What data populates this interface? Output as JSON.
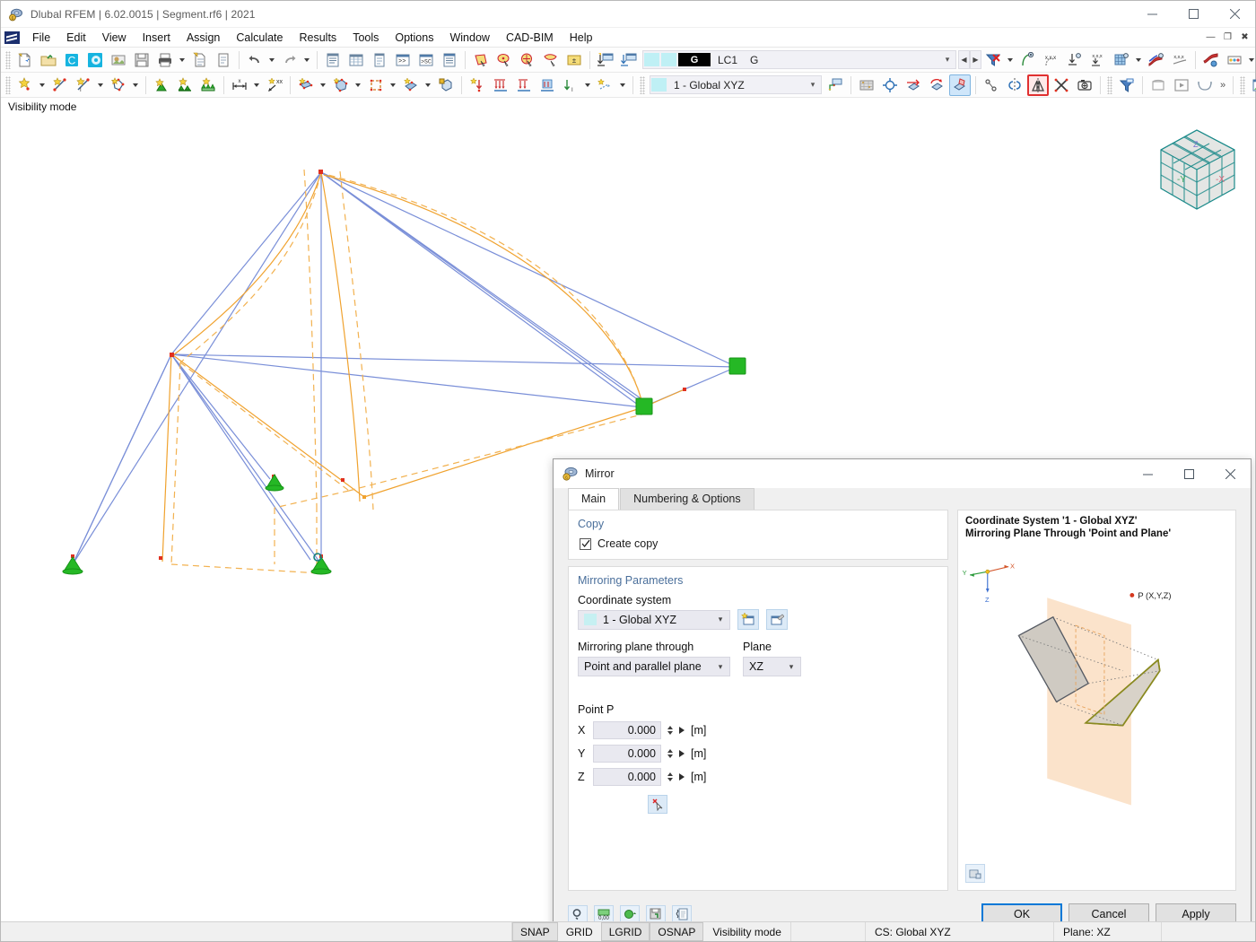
{
  "window": {
    "title": "Dlubal RFEM | 6.02.0015 | Segment.rf6 | 2021",
    "icon": "rfem-app-icon",
    "minimize": "—",
    "maximize": "□",
    "close": "✕"
  },
  "mdi": {
    "minimize": "—",
    "restore": "❐",
    "close": "✖"
  },
  "menu": {
    "items": [
      {
        "label": "File"
      },
      {
        "label": "Edit"
      },
      {
        "label": "View"
      },
      {
        "label": "Insert"
      },
      {
        "label": "Assign"
      },
      {
        "label": "Calculate"
      },
      {
        "label": "Results"
      },
      {
        "label": "Tools"
      },
      {
        "label": "Options"
      },
      {
        "label": "Window"
      },
      {
        "label": "CAD-BIM"
      },
      {
        "label": "Help"
      }
    ]
  },
  "toolbar_main": {
    "load_case_combo": {
      "label_g": "G",
      "case": "LC1",
      "name": "G"
    },
    "nav_left": "◀",
    "nav_right": "▶"
  },
  "toolbar_model": {
    "coordinate_system": "1 - Global XYZ",
    "overflow": "»"
  },
  "status_line": {
    "mode": "Visibility mode"
  },
  "statusbar": {
    "toggles": [
      {
        "label": "SNAP",
        "on": true
      },
      {
        "label": "GRID",
        "on": false
      },
      {
        "label": "LGRID",
        "on": true
      },
      {
        "label": "OSNAP",
        "on": true
      }
    ],
    "mode": "Visibility mode",
    "cs": "CS: Global XYZ",
    "plane": "Plane: XZ"
  },
  "viewcube": {
    "label_x": "-X",
    "label_y": "-Y",
    "label_z": "Z"
  },
  "dialog": {
    "title": "Mirror",
    "icon": "mirror-dialog-icon",
    "minimize": "—",
    "maximize": "□",
    "close": "✕",
    "tabs": [
      {
        "label": "Main",
        "selected": true
      },
      {
        "label": "Numbering & Options",
        "selected": false
      }
    ],
    "copy_section": {
      "header": "Copy",
      "create_copy_label": "Create copy",
      "create_copy_checked": true,
      "check_glyph": "✓"
    },
    "mirroring_section": {
      "header": "Mirroring Parameters",
      "coordinate_system_label": "Coordinate system",
      "coordinate_system_value": "1 - Global XYZ",
      "new_cs_button": "new-coordinate-system-icon",
      "edit_cs_button": "edit-coordinate-system-icon",
      "plane_through_label": "Mirroring plane through",
      "plane_through_value": "Point and parallel plane",
      "plane_label": "Plane",
      "plane_value": "XZ",
      "point_label": "Point P",
      "coords": [
        {
          "axis": "X",
          "value": "0.000",
          "unit": "[m]"
        },
        {
          "axis": "Y",
          "value": "0.000",
          "unit": "[m]"
        },
        {
          "axis": "Z",
          "value": "0.000",
          "unit": "[m]"
        }
      ],
      "pick_point_button": "pick-point-icon"
    },
    "preview": {
      "caption_line1": "Coordinate System '1 - Global XYZ'",
      "caption_line2": "Mirroring Plane Through 'Point and Plane'",
      "axis_x": "X",
      "axis_y": "Y",
      "axis_z": "Z",
      "point_label": "P (X,Y,Z)",
      "settings_button": "preview-settings-icon"
    },
    "footer": {
      "tool_buttons": [
        "help-magnifier-icon",
        "decimal-places-icon",
        "units-icon",
        "save-defaults-icon",
        "comment-icon"
      ],
      "ok": "OK",
      "cancel": "Cancel",
      "apply": "Apply"
    }
  },
  "colors": {
    "member_blue": "#7a8fd8",
    "load_orange": "#f0a22e",
    "node_red": "#e03020",
    "support_green": "#22b522",
    "highlight_red": "#e03030",
    "accent_blue": "#0078d7",
    "section_header": "#4a6f9b",
    "plane_fill": "#fbe3cb"
  }
}
